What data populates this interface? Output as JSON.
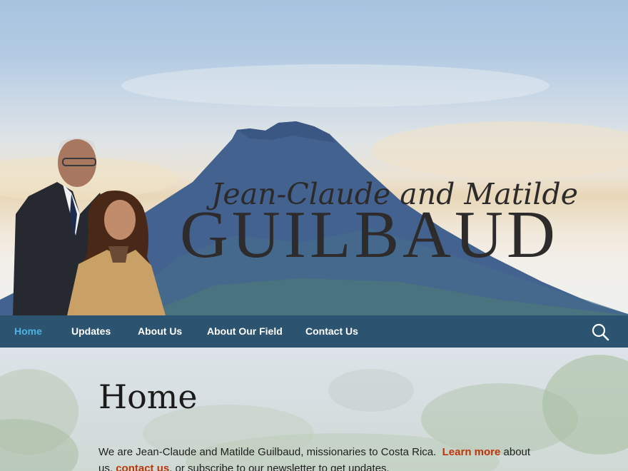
{
  "header": {
    "names_first": "Jean-Claude and Matilde",
    "names_last": "GUILBAUD"
  },
  "nav": {
    "items": [
      {
        "label": "Home",
        "active": true
      },
      {
        "label": "Updates",
        "active": false
      },
      {
        "label": "About Us",
        "active": false
      },
      {
        "label": "About Our Field",
        "active": false
      },
      {
        "label": "Contact Us",
        "active": false
      }
    ],
    "search_icon": "search-icon"
  },
  "page": {
    "title": "Home",
    "intro_part1": "We are Jean-Claude and Matilde Guilbaud, missionaries to Costa Rica.",
    "intro_link1": "Learn more",
    "intro_part2": "about us,",
    "intro_link2": "contact us",
    "intro_part3": ", or subscribe to our newsletter to get updates."
  },
  "colors": {
    "nav_bg": "#2c5470",
    "nav_active": "#4fb1e0",
    "link": "#bc360a"
  }
}
